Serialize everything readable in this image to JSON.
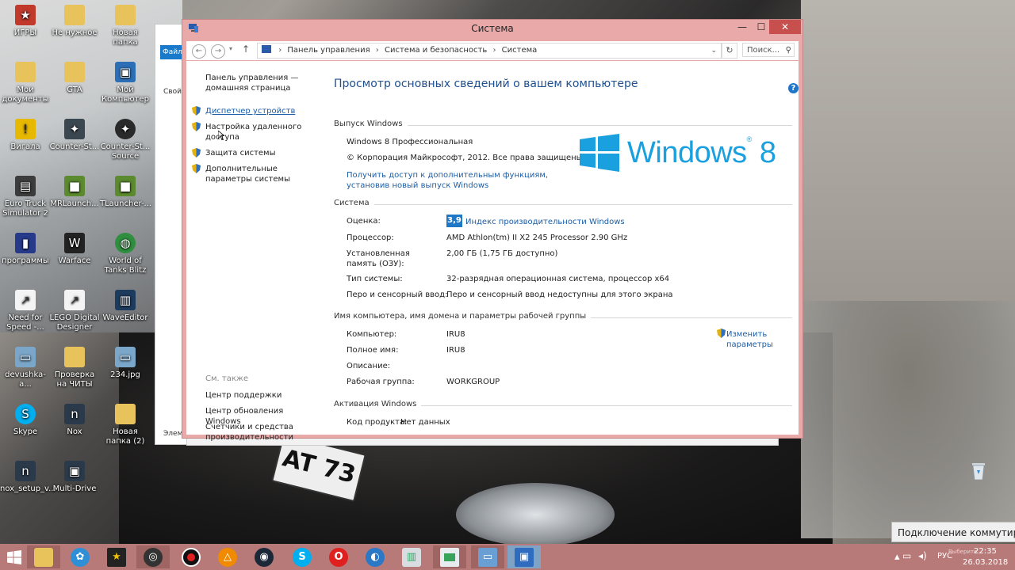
{
  "desktop": {
    "icons": [
      {
        "label": "ИГРЫ"
      },
      {
        "label": "Не нужное"
      },
      {
        "label": "Новая папка"
      },
      {
        "label": "Мои документы"
      },
      {
        "label": "GTA"
      },
      {
        "label": "Мой Компьютер"
      },
      {
        "label": "Вигала"
      },
      {
        "label": "Counter-St..."
      },
      {
        "label": "Counter-St... Source"
      },
      {
        "label": "Euro Truck Simulator 2"
      },
      {
        "label": "MRLaunch..."
      },
      {
        "label": "TLauncher-..."
      },
      {
        "label": "программы"
      },
      {
        "label": "Warface"
      },
      {
        "label": "World of Tanks Blitz"
      },
      {
        "label": "Need for Speed -..."
      },
      {
        "label": "LEGO Digital Designer"
      },
      {
        "label": "WaveEditor"
      },
      {
        "label": "devushka-a..."
      },
      {
        "label": "Проверка на ЧИТЫ"
      },
      {
        "label": "234.jpg"
      },
      {
        "label": "Skype"
      },
      {
        "label": "Nox"
      },
      {
        "label": "Новая папка (2)"
      },
      {
        "label": "nox_setup_v..."
      },
      {
        "label": "Multi-Drive"
      }
    ],
    "plate_text": "AT 73",
    "bg_window": {
      "ribbon_label": "Файл",
      "item1": "Свойс",
      "item2": "Элем"
    }
  },
  "window": {
    "title": "Система",
    "min_label": "—",
    "max_label": "☐",
    "close_label": "✕",
    "breadcrumbs": [
      "Панель управления",
      "Система и безопасность",
      "Система"
    ],
    "search_placeholder": "Поиск...",
    "left_pane": {
      "home": "Панель управления — домашняя страница",
      "links": [
        "Диспетчер устройств",
        "Настройка удаленного доступа",
        "Защита системы",
        "Дополнительные параметры системы"
      ],
      "see_also": "См. также",
      "see_also_links": [
        "Центр поддержки",
        "Центр обновления Windows",
        "Счетчики и средства производительности"
      ]
    },
    "main": {
      "heading": "Просмотр основных сведений о вашем компьютере",
      "edition_section": "Выпуск Windows",
      "edition": "Windows 8 Профессиональная",
      "copyright": "© Корпорация Майкрософт, 2012. Все права защищены.",
      "upgrade_link": "Получить доступ к дополнительным функциям, установив новый выпуск Windows",
      "logo_text": "Windows",
      "logo_number": "8",
      "system_section": "Система",
      "rating_label": "Оценка:",
      "rating_value": "3,9",
      "rating_link": "Индекс производительности Windows",
      "cpu_label": "Процессор:",
      "cpu_value": "AMD Athlon(tm) II X2 245 Processor   2.90 GHz",
      "ram_label": "Установленная память (ОЗУ):",
      "ram_value": "2,00 ГБ (1,75 ГБ доступно)",
      "type_label": "Тип системы:",
      "type_value": "32-разрядная операционная система, процессор x64",
      "pen_label": "Перо и сенсорный ввод:",
      "pen_value": "Перо и сенсорный ввод недоступны для этого экрана",
      "name_section": "Имя компьютера, имя домена и параметры рабочей группы",
      "computer_label": "Компьютер:",
      "computer_value": "IRU8",
      "fullname_label": "Полное имя:",
      "fullname_value": "IRU8",
      "desc_label": "Описание:",
      "desc_value": "",
      "workgroup_label": "Рабочая группа:",
      "workgroup_value": "WORKGROUP",
      "change_link": "Изменить параметры",
      "activation_section": "Активация Windows",
      "product_label": "Код продукта:",
      "product_value": "Нет данных"
    }
  },
  "notification": "Подключение коммутиру",
  "taskbar": {
    "apps": [
      "start",
      "file-explorer",
      "media-player",
      "movie-maker",
      "obs",
      "recorder",
      "avast",
      "steam",
      "skype",
      "opera",
      "chrome",
      "task-manager",
      "photo-viewer",
      "system-window",
      "remote-desktop"
    ],
    "lang": "РУС",
    "time": "22:35",
    "date": "26.03.2018",
    "watermark": "Выберите..."
  },
  "colors": {
    "accent": "#1a5ea8",
    "titlebar": "#e9a9a9",
    "taskbar": "#b87a78",
    "close": "#c7504e",
    "logo": "#1aa0de"
  }
}
